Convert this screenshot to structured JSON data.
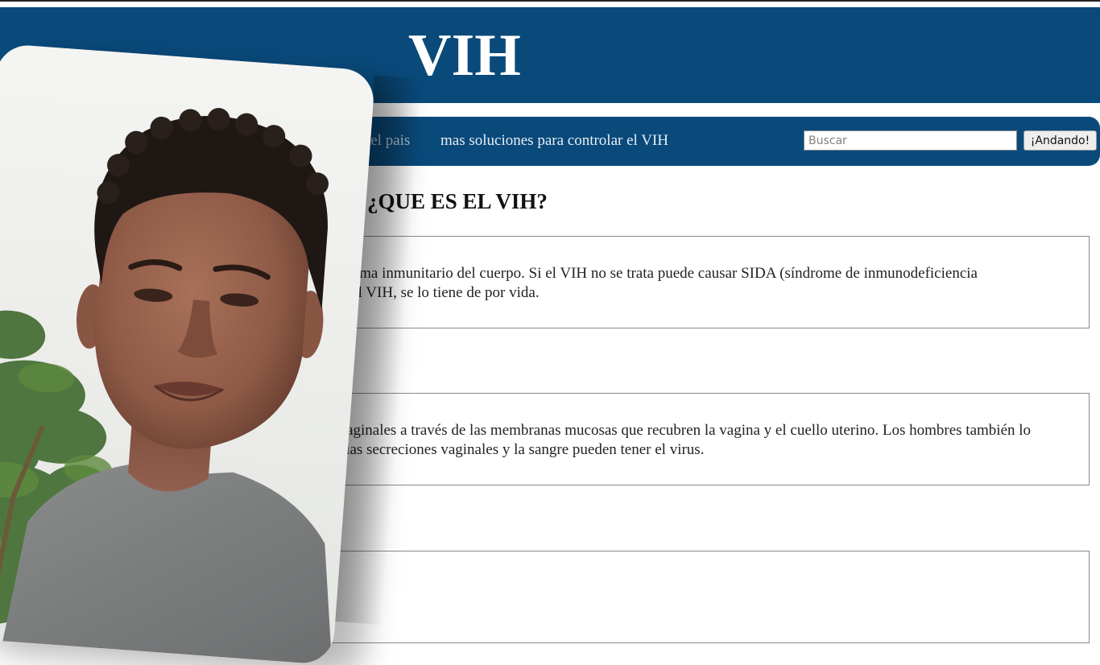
{
  "header": {
    "title": "VIH"
  },
  "nav": {
    "items": [
      {
        "label": "n el pais"
      },
      {
        "label": "mas soluciones para controlar el VIH"
      }
    ],
    "search": {
      "placeholder": "Buscar",
      "button_label": "¡Andando!"
    }
  },
  "main": {
    "section_title": "¿QUE ES EL VIH?",
    "boxes": [
      {
        "lines": [
          "stema inmunitario del cuerpo. Si el VIH no se trata puede causar SIDA (síndrome de inmunodeficiencia",
          "e el VIH, se lo tiene de por vida."
        ]
      },
      {
        "lines": [
          "es vaginales a través de las membranas mucosas que recubren la vagina y el cuello uterino. Los hombres también lo",
          "que las secreciones vaginales y la sangre pueden tener el virus."
        ]
      },
      {
        "lines": []
      }
    ]
  },
  "colors": {
    "header_bg": "#0a4a7b",
    "nav_bg": "#0a4a7b",
    "title_text": "#ffffff"
  },
  "photo": {
    "subject": "portrait-photo"
  }
}
